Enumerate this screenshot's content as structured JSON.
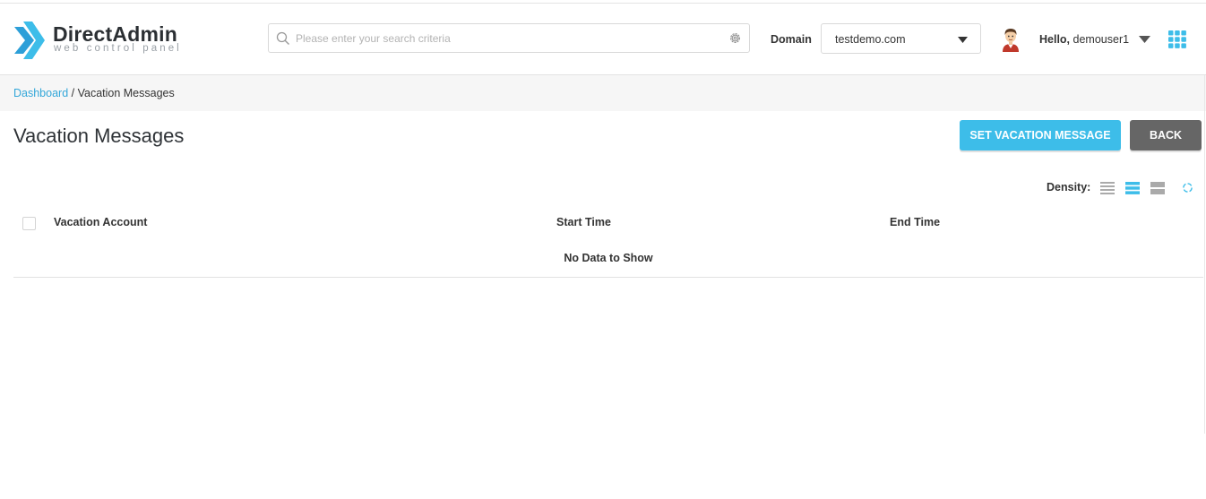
{
  "brand": {
    "name": "DirectAdmin",
    "tagline": "web control panel",
    "accent": "#3dbde9"
  },
  "search": {
    "placeholder": "Please enter your search criteria",
    "value": ""
  },
  "domain": {
    "label": "Domain",
    "selected": "testdemo.com"
  },
  "user": {
    "greeting": "Hello,",
    "username": "demouser1"
  },
  "breadcrumb": {
    "home": "Dashboard",
    "separator": " / ",
    "current": "Vacation Messages"
  },
  "page": {
    "title": "Vacation Messages"
  },
  "actions": {
    "set_vacation": "SET VACATION MESSAGE",
    "back": "BACK"
  },
  "density": {
    "label": "Density:",
    "options": [
      "compact",
      "normal",
      "comfortable"
    ],
    "selected": "normal"
  },
  "table": {
    "columns": [
      "Vacation Account",
      "Start Time",
      "End Time"
    ],
    "rows": [],
    "empty_text": "No Data to Show"
  },
  "icons": {
    "search": "search-icon",
    "settings": "gear-icon",
    "caret": "caret-down-icon",
    "avatar": "user-avatar",
    "apps": "apps-grid-icon",
    "refresh": "refresh-icon"
  }
}
